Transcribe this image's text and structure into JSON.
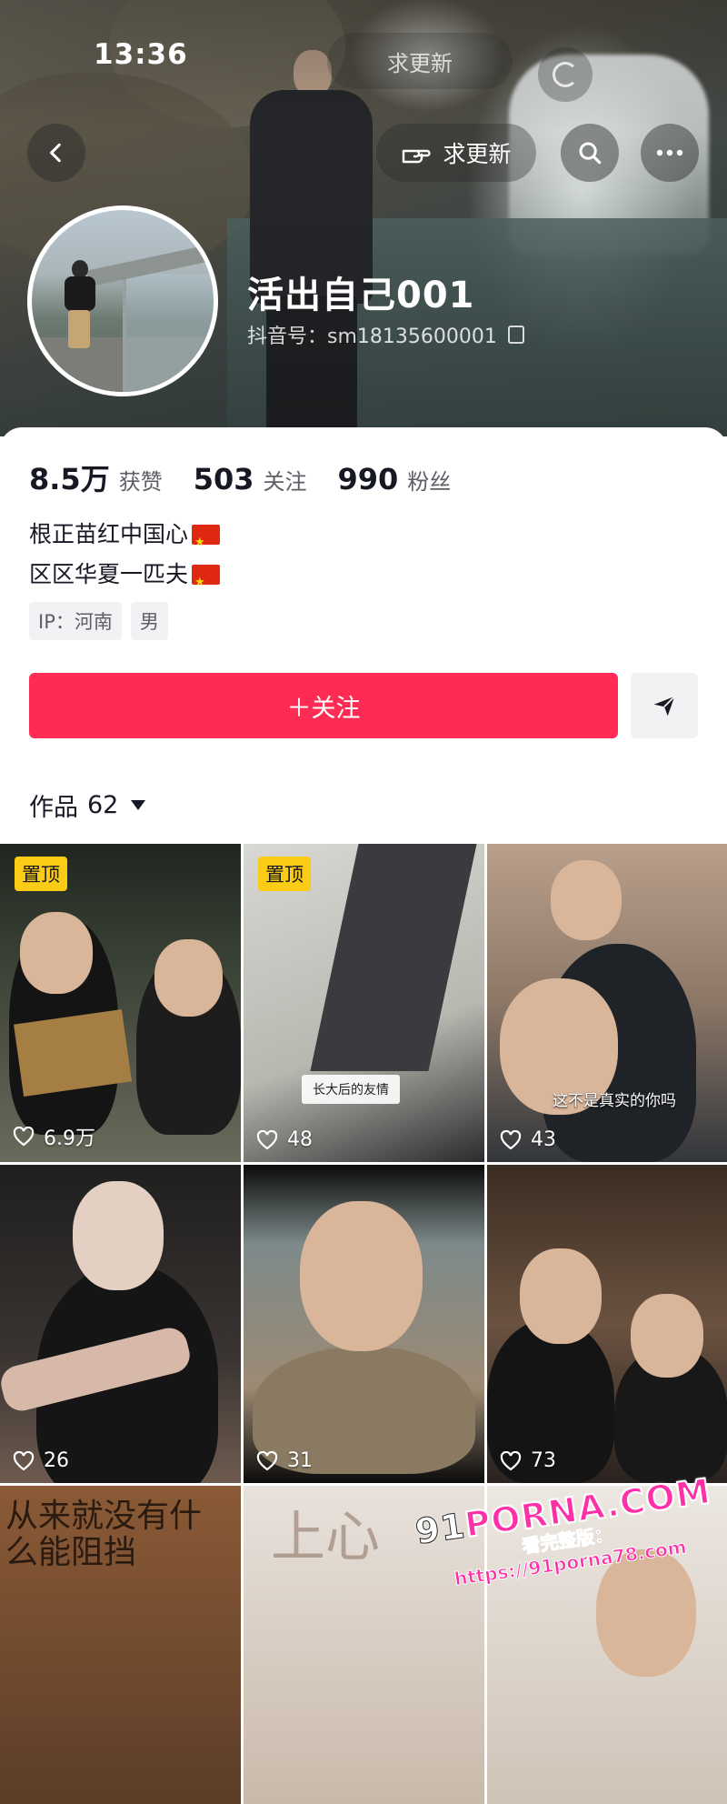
{
  "status_bar": {
    "time": "13:36"
  },
  "header": {
    "ghost_update_label": "求更新",
    "update_label": "求更新"
  },
  "profile": {
    "nickname": "活出自己001",
    "douyin_id": "抖音号：sm18135600001"
  },
  "stats": [
    {
      "value": "8.5万",
      "label": "获赞"
    },
    {
      "value": "503",
      "label": "关注"
    },
    {
      "value": "990",
      "label": "粉丝"
    }
  ],
  "bio": {
    "line1": "根正苗红中国心",
    "line2": "区区华夏一匹夫"
  },
  "tags": [
    "IP：河南",
    "男"
  ],
  "actions": {
    "follow_label": "＋关注"
  },
  "works": {
    "label": "作品",
    "count": "62"
  },
  "grid": [
    {
      "pinned": true,
      "pin_label": "置顶",
      "likes": "6.9万"
    },
    {
      "pinned": true,
      "pin_label": "置顶",
      "likes": "48",
      "caption": "长大后的友情"
    },
    {
      "pinned": false,
      "likes": "43",
      "caption": "这不是真实的你吗"
    },
    {
      "pinned": false,
      "likes": "26"
    },
    {
      "pinned": false,
      "likes": "31"
    },
    {
      "pinned": false,
      "likes": "73"
    },
    {
      "sign_text": "从来就没有什么能阻挡"
    },
    {
      "sign_text": "上心"
    },
    {}
  ],
  "watermark": {
    "brand_prefix": "91",
    "brand": "PORNA.COM",
    "url": "看完整版：https://91porna78.com"
  },
  "colors": {
    "accent": "#fe2c55",
    "pin": "#facc15"
  }
}
